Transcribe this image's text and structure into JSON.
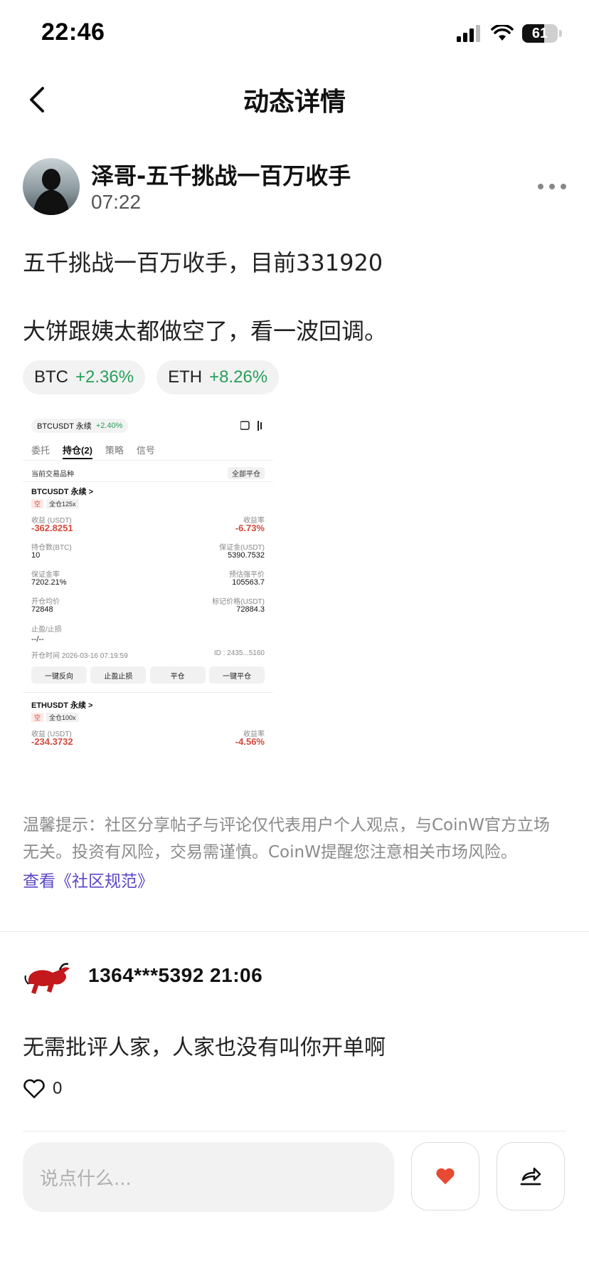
{
  "status_bar": {
    "time": "22:46",
    "battery": "61"
  },
  "nav": {
    "title": "动态详情"
  },
  "post": {
    "author": "泽哥-五千挑战一百万收手",
    "time": "07:22",
    "lines": [
      "五千挑战一百万收手，目前331920",
      "大饼跟姨太都做空了，看一波回调。"
    ],
    "tags": [
      {
        "symbol": "BTC",
        "change": "+2.36%"
      },
      {
        "symbol": "ETH",
        "change": "+8.26%"
      }
    ]
  },
  "screenshot": {
    "header_symbol": "BTCUSDT 永续",
    "header_change": "+2.40%",
    "tabs": [
      "委托",
      "持仓(2)",
      "策略",
      "信号"
    ],
    "current_only": "当前交易品种",
    "close_all": "全部平仓",
    "pos1": {
      "symbol": "BTCUSDT 永续 >",
      "side": "空",
      "leverage": "全仓125x",
      "pnl_label": "收益 (USDT)",
      "pnl": "-362.8251",
      "roi_label": "收益率",
      "roi": "-6.73%",
      "size_label": "持仓数(BTC)",
      "size": "10",
      "margin_label": "保证金(USDT)",
      "margin": "5390.7532",
      "ratio_label": "保证金率",
      "ratio": "7202.21%",
      "liq_label": "预估强平价",
      "liq": "105563.7",
      "entry_label": "开仓均价",
      "entry": "72848",
      "mark_label": "标记价格(USDT)",
      "mark": "72884.3",
      "tpsl_label": "止盈/止损",
      "tpsl": "--/--",
      "open_time": "开仓时间 2026-03-16 07:19:59",
      "id": "ID : 2435...5160"
    },
    "buttons": [
      "一键反向",
      "止盈止损",
      "平仓",
      "一键平仓"
    ],
    "pos2": {
      "symbol": "ETHUSDT 永续 >",
      "side": "空",
      "leverage": "全仓100x",
      "pnl_label": "收益 (USDT)",
      "pnl": "-234.3732",
      "roi_label": "收益率",
      "roi": "-4.56%"
    }
  },
  "disclaimer": "温馨提示：社区分享帖子与评论仅代表用户个人观点，与CoinW官方立场无关。投资有风险，交易需谨慎。CoinW提醒您注意相关市场风险。",
  "rules_link": "查看《社区规范》",
  "comment": {
    "user_time": "1364***5392 21:06",
    "text": "无需批评人家，人家也没有叫你开单啊",
    "likes": "0"
  },
  "input": {
    "placeholder": "说点什么..."
  },
  "colors": {
    "green": "#27a05a",
    "red": "#d2493b",
    "link": "#5a48c8",
    "heart": "#e64a32"
  }
}
